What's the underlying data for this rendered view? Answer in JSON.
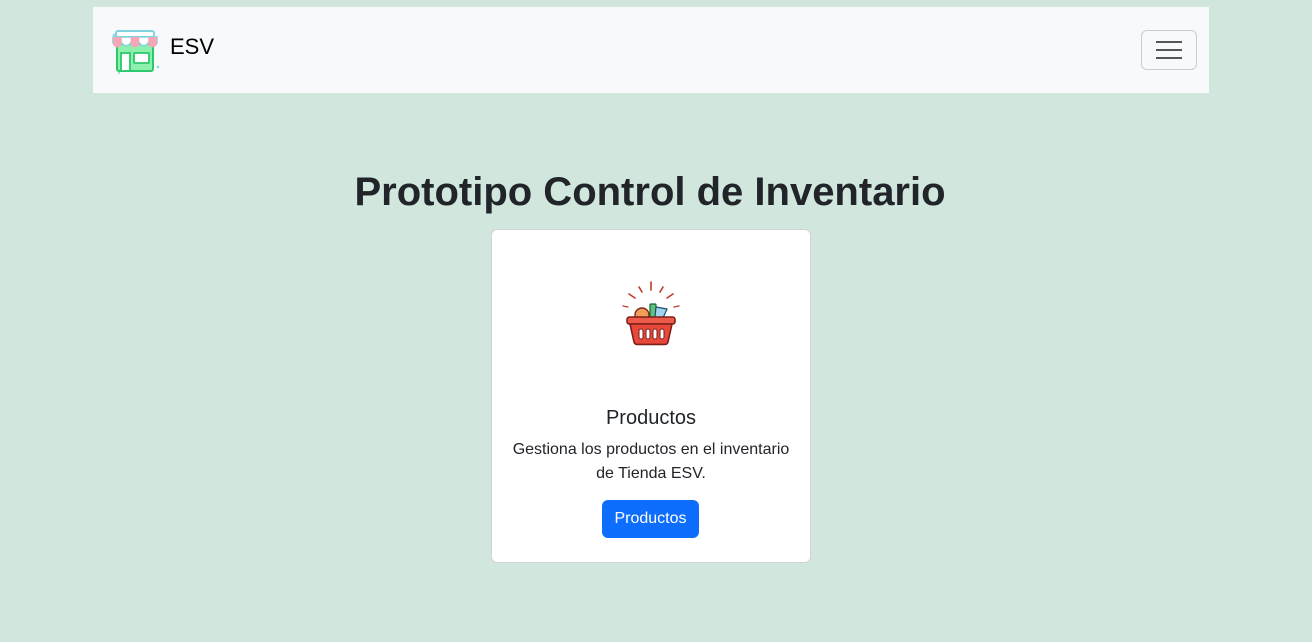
{
  "navbar": {
    "brand_text": "ESV",
    "brand_logo_icon": "storefront-icon",
    "toggler_icon": "hamburger-menu-icon",
    "background": "#f8f9fa"
  },
  "main": {
    "title": "Prototipo Control de Inventario",
    "card": {
      "image_icon": "grocery-basket-icon",
      "title": "Productos",
      "text": "Gestiona los productos en el inventario de Tienda ESV.",
      "button_label": "Productos"
    }
  },
  "colors": {
    "page_background": "#d1e7dd",
    "primary": "#0d6efd",
    "text": "#212529"
  }
}
